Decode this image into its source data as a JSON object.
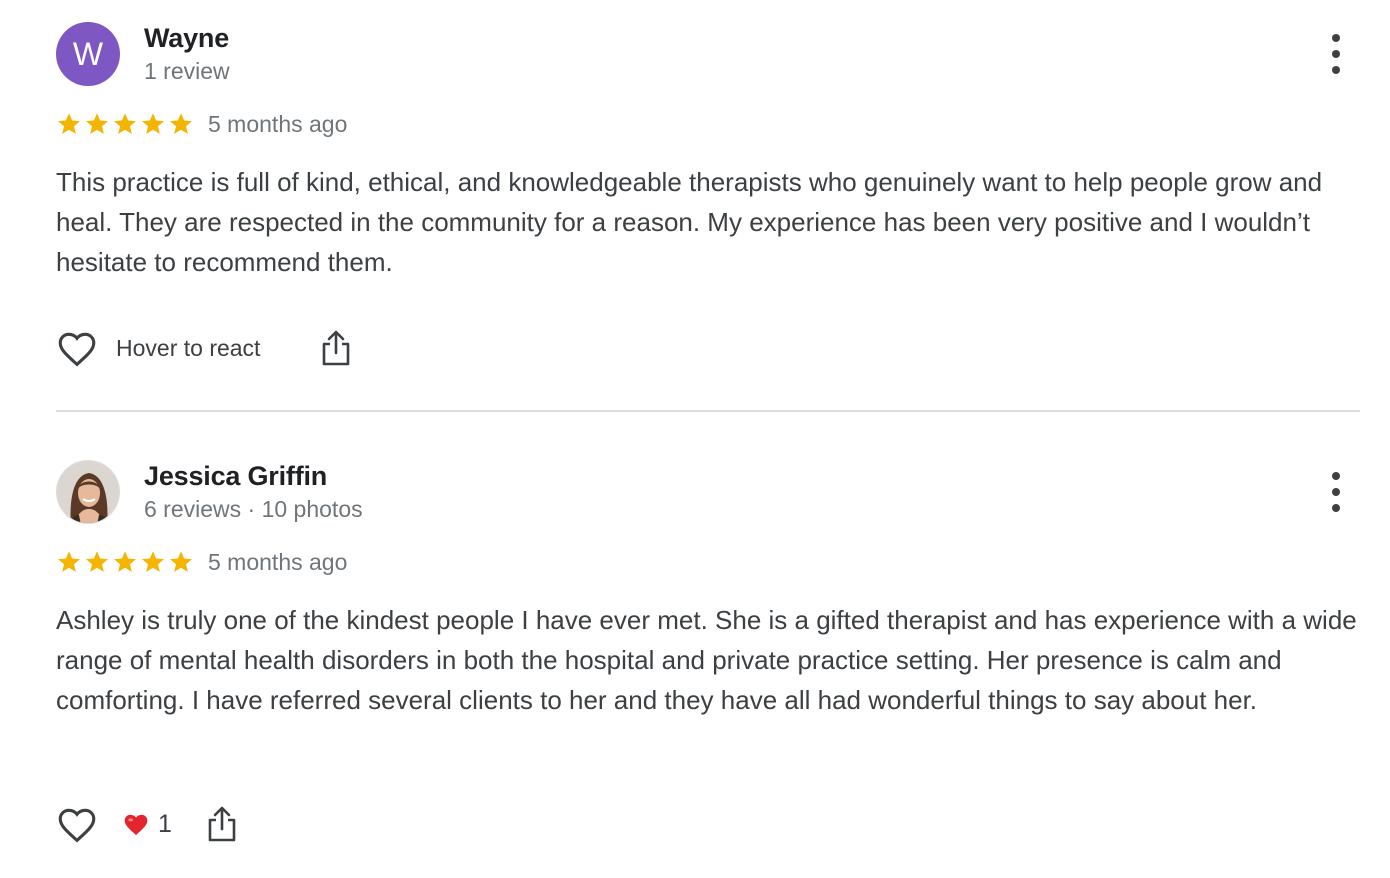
{
  "reviews": [
    {
      "author": "Wayne",
      "avatar_letter": "W",
      "avatar_color": "#7e57c2",
      "meta": "1 review",
      "rating": 5,
      "timestamp": "5 months ago",
      "text": "This practice is full of kind, ethical, and knowledgeable therapists who genuinely want to help people grow and heal. They are respected in the community for a reason. My experience has been very positive and I wouldn’t hesitate to recommend them.",
      "hover_label": "Hover to react"
    },
    {
      "author": "Jessica Griffin",
      "meta": "6 reviews · 10 photos",
      "rating": 5,
      "timestamp": "5 months ago",
      "text": "Ashley is truly one of the kindest people I have ever met. She is a gifted therapist and has experience with a wide range of mental health disorders in both the hospital and private practice setting. Her presence is calm and comforting. I have referred several clients to her and they have all had wonderful things to say about her.",
      "reaction_emoji": "❤️",
      "reaction_count": "1"
    }
  ],
  "colors": {
    "star": "#f4b400",
    "text": "#3c4043",
    "meta": "#70757a",
    "divider": "#dadce0"
  },
  "icons": [
    "more-vert-icon",
    "star-icon",
    "heart-outline-icon",
    "share-icon",
    "heart-filled-icon"
  ]
}
